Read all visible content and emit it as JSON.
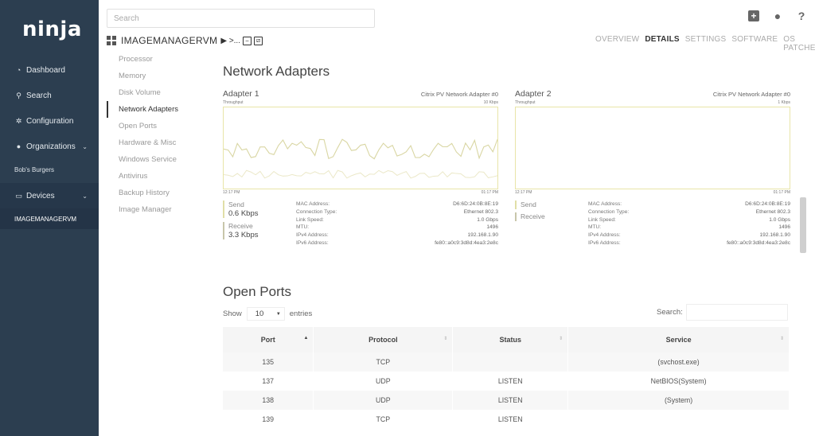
{
  "brand": {
    "logo": "ninja"
  },
  "sidebar": {
    "items": [
      {
        "icon": "dashboard-icon",
        "label": "Dashboard"
      },
      {
        "icon": "search-icon",
        "label": "Search"
      },
      {
        "icon": "gear-icon",
        "label": "Configuration"
      },
      {
        "icon": "user-icon",
        "label": "Organizations"
      },
      {
        "sub": "Bob's Burgers"
      },
      {
        "icon": "monitor-icon",
        "label": "Devices"
      },
      {
        "sub": "IMAGEMANAGERVM"
      }
    ]
  },
  "search": {
    "placeholder": "Search"
  },
  "device": {
    "name": "IMAGEMANAGERVM",
    "action_glyph": "▶ >..."
  },
  "subnav": [
    "Processor",
    "Memory",
    "Disk Volume",
    "Network Adapters",
    "Open Ports",
    "Hardware & Misc",
    "Windows Service",
    "Antivirus",
    "Backup History",
    "Image Manager"
  ],
  "tabs": [
    "OVERVIEW",
    "DETAILS",
    "SETTINGS",
    "SOFTWARE",
    "OS PATCHES"
  ],
  "active_tab": "DETAILS",
  "network": {
    "title": "Network Adapters",
    "adapters": [
      {
        "name": "Adapter 1",
        "model": "Citrix PV Network Adapter #0",
        "throughput_label": "Throughput",
        "scale": "10 Kbps",
        "time_start": "12:17 PM",
        "time_end": "01:17 PM",
        "send_label": "Send",
        "send_value": "0.6 Kbps",
        "receive_label": "Receive",
        "receive_value": "3.3 Kbps",
        "props": [
          [
            "MAC Address:",
            "D6:6D:24:0B:8E:19"
          ],
          [
            "Connection Type:",
            "Ethernet 802.3"
          ],
          [
            "Link Speed:",
            "1.0 Gbps"
          ],
          [
            "MTU:",
            "1496"
          ],
          [
            "IPv4 Address:",
            "192.168.1.90"
          ],
          [
            "IPv6 Address:",
            "fe80::a0c9:3d8d:4ea3:2e8c"
          ]
        ]
      },
      {
        "name": "Adapter 2",
        "model": "Citrix PV Network Adapter #0",
        "throughput_label": "Throughput",
        "scale": "1 Kbps",
        "time_start": "12:17 PM",
        "time_end": "01:17 PM",
        "send_label": "Send",
        "send_value": "",
        "receive_label": "Receive",
        "receive_value": "",
        "props": [
          [
            "MAC Address:",
            "D6:6D:24:0B:8E:19"
          ],
          [
            "Connection Type:",
            "Ethernet 802.3"
          ],
          [
            "Link Speed:",
            "1.0 Gbps"
          ],
          [
            "MTU:",
            "1496"
          ],
          [
            "IPv4 Address:",
            "192.168.1.90"
          ],
          [
            "IPv6 Address:",
            "fe80::a0c9:3d8d:4ea3:2e8c"
          ]
        ]
      }
    ]
  },
  "ports": {
    "title": "Open Ports",
    "show_label": "Show",
    "page_size": "10",
    "entries_label": "entries",
    "search_label": "Search:",
    "columns": [
      "Port",
      "Protocol",
      "Status",
      "Service"
    ],
    "rows": [
      [
        "135",
        "TCP",
        "",
        "(svchost.exe)"
      ],
      [
        "137",
        "UDP",
        "LISTEN",
        "NetBIOS(System)"
      ],
      [
        "138",
        "UDP",
        "LISTEN",
        "(System)"
      ],
      [
        "139",
        "TCP",
        "LISTEN",
        ""
      ]
    ]
  }
}
